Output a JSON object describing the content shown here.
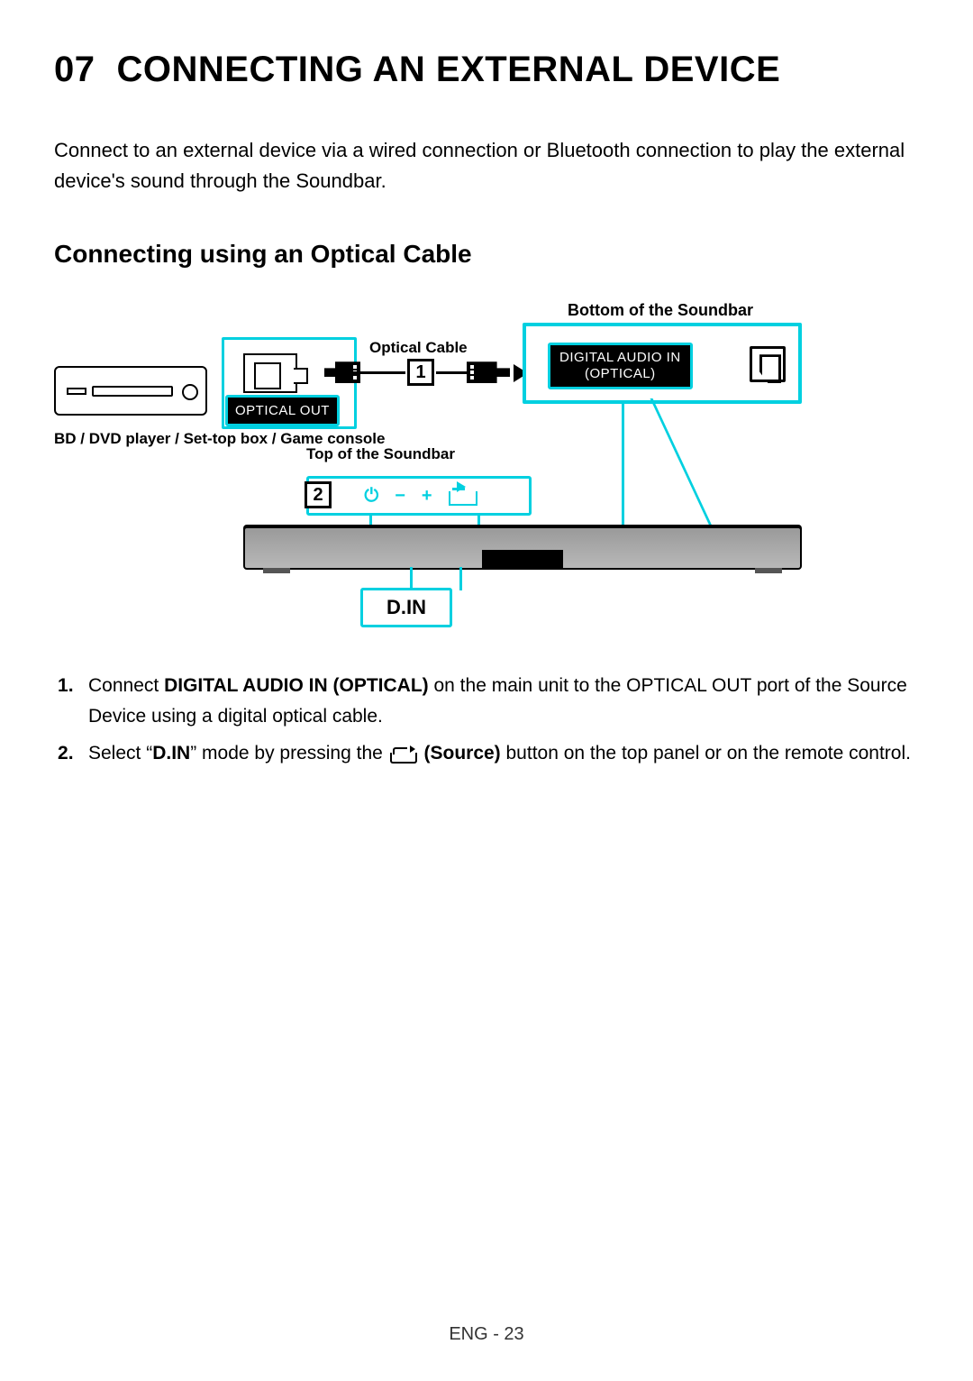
{
  "chapter": {
    "number": "07",
    "title": "CONNECTING AN EXTERNAL DEVICE"
  },
  "intro": "Connect to an external device via a wired connection or Bluetooth connection to play the external device's sound through the Soundbar.",
  "section_title": "Connecting using an Optical Cable",
  "diagram": {
    "bottom_label": "Bottom of the Soundbar",
    "optical_cable_label": "Optical Cable",
    "source_device_label": "BD / DVD player / Set-top box / Game console",
    "optical_out_label": "OPTICAL OUT",
    "digital_audio_in_line1": "DIGITAL AUDIO IN",
    "digital_audio_in_line2": "(OPTICAL)",
    "top_label": "Top of the Soundbar",
    "step1_badge": "1",
    "step2_badge": "2",
    "din_label": "D.IN",
    "top_panel_buttons": {
      "power": "⏻",
      "vol_down": "−",
      "vol_up": "+"
    }
  },
  "steps": {
    "s1_pre": "Connect ",
    "s1_bold": "DIGITAL AUDIO IN (OPTICAL)",
    "s1_post": " on the main unit to the OPTICAL OUT port of the Source Device using a digital optical cable.",
    "s2_pre": "Select “",
    "s2_bold1": "D.IN",
    "s2_mid": "” mode by pressing the ",
    "s2_bold2": " (Source)",
    "s2_post": " button on the top panel or on the remote control."
  },
  "footer": "ENG - 23"
}
